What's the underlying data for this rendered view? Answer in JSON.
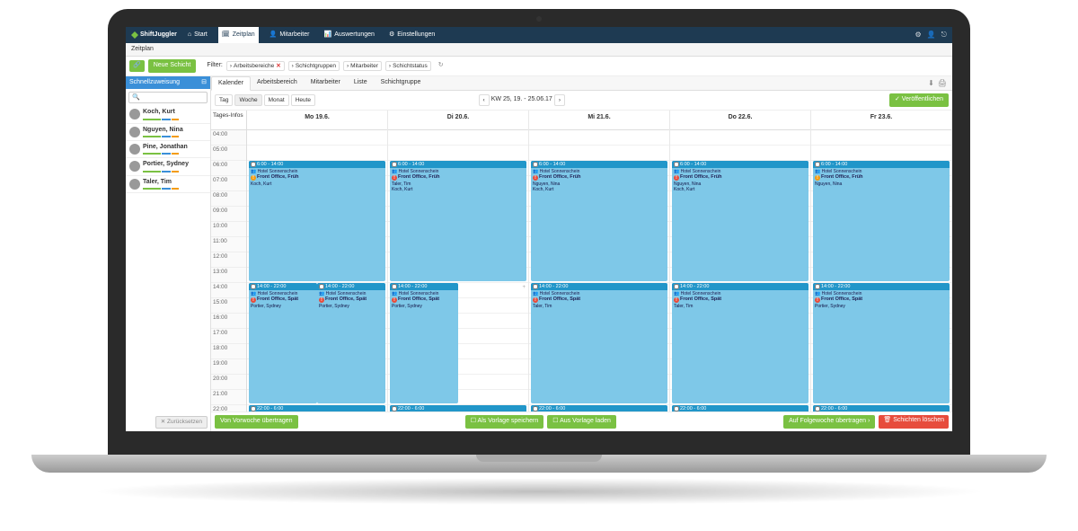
{
  "brand": "ShiftJuggler",
  "nav": {
    "start": "Start",
    "zeitplan": "Zeitplan",
    "mitarbeiter": "Mitarbeiter",
    "auswertungen": "Auswertungen",
    "einstellungen": "Einstellungen"
  },
  "crumb": "Zeitplan",
  "newShift": "Neue Schicht",
  "filterLabel": "Filter:",
  "filters": {
    "f1": "Arbeitsbereiche",
    "f2": "Schichtgruppen",
    "f3": "Mitarbeiter",
    "f4": "Schichtstatus"
  },
  "sidebar": {
    "title": "Schnellzuweisung",
    "searchPlaceholder": "🔍",
    "employees": [
      {
        "name": "Koch, Kurt"
      },
      {
        "name": "Nguyen, Nina"
      },
      {
        "name": "Pine, Jonathan"
      },
      {
        "name": "Portier, Sydney"
      },
      {
        "name": "Taler, Tim"
      }
    ],
    "clearBtn": "✕ Zurücksetzen"
  },
  "tabs": {
    "t1": "Kalender",
    "t2": "Arbeitsbereich",
    "t3": "Mitarbeiter",
    "t4": "Liste",
    "t5": "Schichtgruppe"
  },
  "controls": {
    "tag": "Tag",
    "woche": "Woche",
    "monat": "Monat",
    "heute": "Heute",
    "range": "KW 25, 19. - 25.06.17",
    "publish": "✓ Veröffentlichen"
  },
  "tagesInfos": "Tages-Infos",
  "hours": [
    "04:00",
    "05:00",
    "06:00",
    "07:00",
    "08:00",
    "09:00",
    "10:00",
    "11:00",
    "12:00",
    "13:00",
    "14:00",
    "15:00",
    "16:00",
    "17:00",
    "18:00",
    "19:00",
    "20:00",
    "21:00",
    "22:00"
  ],
  "days": [
    "Mo 19.6.",
    "Di 20.6.",
    "Mi 21.6.",
    "Do 22.6.",
    "Fr 23.6."
  ],
  "shiftLabels": {
    "morning": "6:00 - 14:00",
    "late": "14:00 - 22:00",
    "night": "22:00 - 6:00",
    "hotel": "Hotel Sonnenschein",
    "grpFruh": "Front Office, Früh",
    "grpSpat": "Front Office, Spät"
  },
  "morningShifts": [
    {
      "warn": "y",
      "emps": "Koch, Kurt"
    },
    {
      "warn": "r",
      "emps": "Taler, Tim\nKoch, Kurt"
    },
    {
      "warn": "r",
      "emps": "Nguyen, Nina\nKoch, Kurt"
    },
    {
      "warn": "r",
      "emps": "Nguyen, Nina\nKoch, Kurt"
    },
    {
      "warn": "y",
      "emps": "Nguyen, Nina"
    }
  ],
  "lateShifts": [
    {
      "half": true,
      "warn": "r",
      "emps": "Portier, Sydney"
    },
    {
      "half": true,
      "warn": "r",
      "emps": "Portier, Sydney"
    },
    {
      "half": false,
      "warn": "r",
      "emps": "Taler, Tim"
    },
    {
      "half": false,
      "warn": "r",
      "emps": "Taler, Tim"
    },
    {
      "half": false,
      "warn": "r",
      "emps": "Portier, Sydney"
    }
  ],
  "monLateRight": {
    "emps": "Portier, Sydney"
  },
  "footer": {
    "prev": "Von Vorwoche übertragen",
    "saveTpl": "☐ Als Vorlage speichern",
    "loadTpl": "☐ Aus Vorlage laden",
    "next": "Auf Folgewoche übertragen ›",
    "delete": "🗑 Schichten löschen"
  }
}
